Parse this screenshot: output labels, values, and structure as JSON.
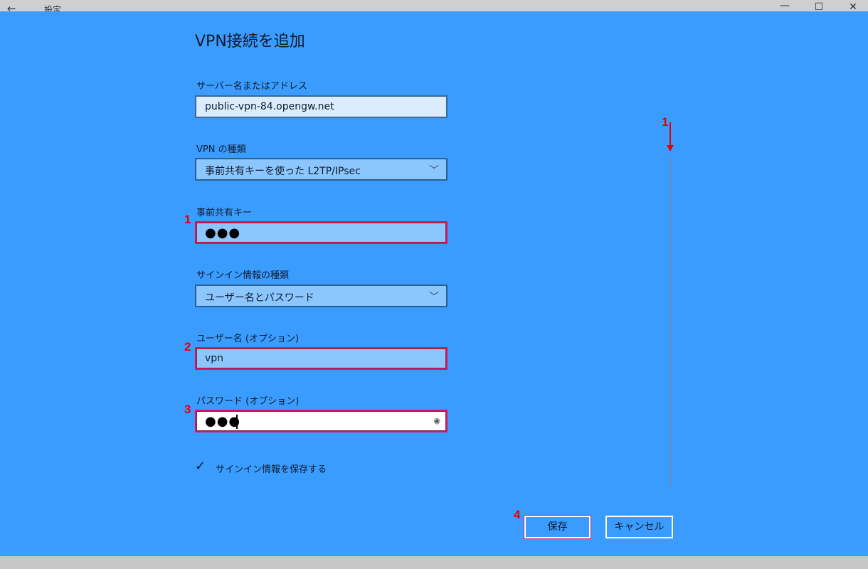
{
  "window": {
    "back_icon": "←",
    "title": "設定",
    "minimize_icon": "—",
    "maximize_icon": "☐",
    "close_icon": "✕"
  },
  "dialog": {
    "heading": "VPN接続を追加",
    "server": {
      "label": "サーバー名またはアドレス",
      "value": "public-vpn-84.opengw.net"
    },
    "vpn_type": {
      "label": "VPN の種類",
      "value": "事前共有キーを使った L2TP/IPsec"
    },
    "psk": {
      "label": "事前共有キー",
      "value": "●●●"
    },
    "signin_type": {
      "label": "サインイン情報の種類",
      "value": "ユーザー名とパスワード"
    },
    "username": {
      "label": "ユーザー名 (オプション)",
      "value": "vpn"
    },
    "password": {
      "label": "パスワード (オプション)",
      "value": "●●●"
    },
    "remember": {
      "label": "サインイン情報を保存する",
      "checked": true,
      "check_icon": "✓"
    },
    "save_label": "保存",
    "cancel_label": "キャンセル"
  },
  "annotations": {
    "m1": "1",
    "m2": "2",
    "m3": "3",
    "m4": "4",
    "m1b": "1"
  },
  "icons": {
    "chevron": "﹀",
    "eye": "◉"
  },
  "colors": {
    "background": "#3b9cff",
    "highlight": "#e0125a",
    "marker": "#e30000"
  }
}
